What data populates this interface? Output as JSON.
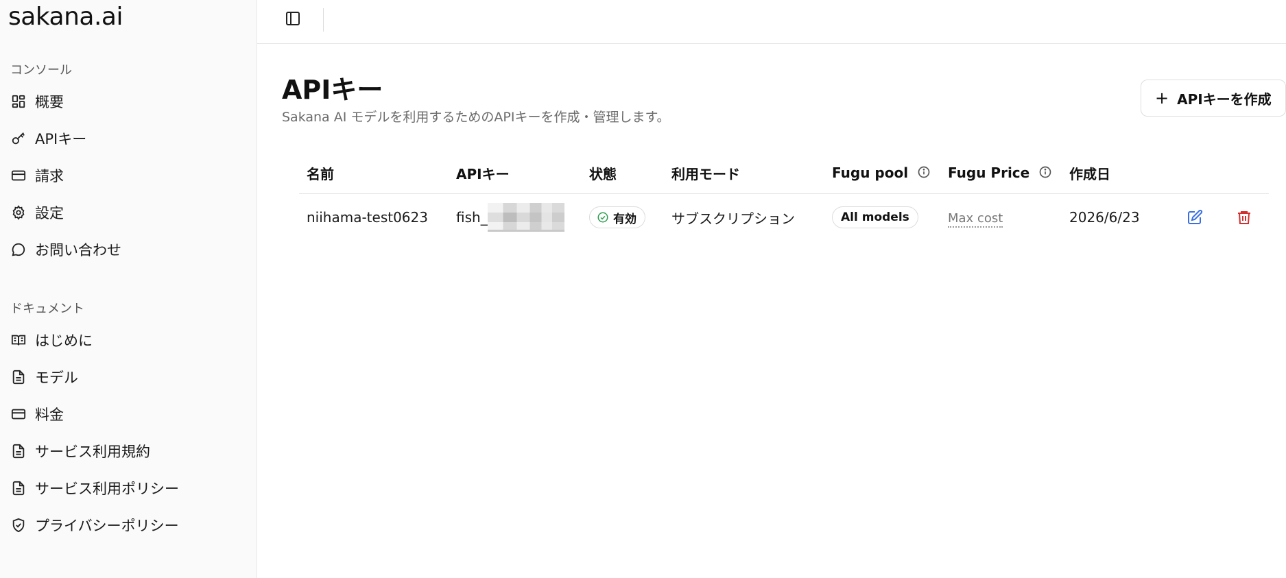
{
  "sidebar": {
    "logo": "sakana.ai",
    "console_label": "コンソール",
    "console_items": [
      {
        "label": "概要",
        "icon": "dashboard-icon"
      },
      {
        "label": "APIキー",
        "icon": "key-icon"
      },
      {
        "label": "請求",
        "icon": "credit-card-icon"
      },
      {
        "label": "設定",
        "icon": "gear-icon"
      },
      {
        "label": "お問い合わせ",
        "icon": "chat-bubble-icon"
      }
    ],
    "docs_label": "ドキュメント",
    "docs_items": [
      {
        "label": "はじめに",
        "icon": "open-book-icon"
      },
      {
        "label": "モデル",
        "icon": "document-icon"
      },
      {
        "label": "料金",
        "icon": "credit-card-icon"
      },
      {
        "label": "サービス利用規約",
        "icon": "document-icon"
      },
      {
        "label": "サービス利用ポリシー",
        "icon": "document-icon"
      },
      {
        "label": "プライバシーポリシー",
        "icon": "shield-check-icon"
      }
    ]
  },
  "main": {
    "title": "APIキー",
    "subtitle": "Sakana AI モデルを利用するためのAPIキーを作成・管理します。",
    "create_button_label": "APIキーを作成",
    "table": {
      "headers": [
        "名前",
        "APIキー",
        "状態",
        "利用モード",
        "Fugu pool",
        "Fugu Price",
        "作成日"
      ],
      "rows": [
        {
          "name": "niihama-test0623",
          "key_prefix": "fish_",
          "status": "有効",
          "mode": "サブスクリプション",
          "pool": "All models",
          "price": "Max cost",
          "created": "2026/6/23"
        }
      ]
    }
  },
  "colors": {
    "status_ok": "#2e9e4f",
    "edit": "#3b6fe0",
    "delete": "#d32f2f"
  }
}
